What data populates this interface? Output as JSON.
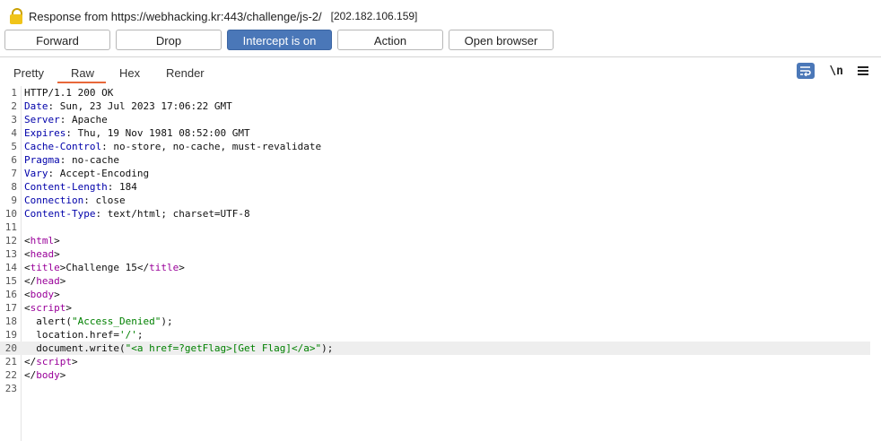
{
  "header": {
    "title": "Response from https://webhacking.kr:443/challenge/js-2/",
    "ip": "[202.182.106.159]"
  },
  "toolbar": {
    "buttons": [
      {
        "label": "Forward"
      },
      {
        "label": "Drop"
      },
      {
        "label": "Intercept is on",
        "active": true
      },
      {
        "label": "Action"
      },
      {
        "label": "Open browser"
      }
    ]
  },
  "tabs": [
    {
      "label": "Pretty"
    },
    {
      "label": "Raw",
      "active": true
    },
    {
      "label": "Hex"
    },
    {
      "label": "Render"
    }
  ],
  "tools": {
    "newline_label": "\\n"
  },
  "editor": {
    "highlighted_line": 20,
    "lines": [
      {
        "n": "1",
        "segments": [
          {
            "t": "HTTP/1.1 200 OK",
            "c": "plain"
          }
        ]
      },
      {
        "n": "2",
        "segments": [
          {
            "t": "Date",
            "c": "k"
          },
          {
            "t": ": Sun, 23 Jul 2023 17:06:22 GMT",
            "c": "plain"
          }
        ]
      },
      {
        "n": "3",
        "segments": [
          {
            "t": "Server",
            "c": "k"
          },
          {
            "t": ": Apache",
            "c": "plain"
          }
        ]
      },
      {
        "n": "4",
        "segments": [
          {
            "t": "Expires",
            "c": "k"
          },
          {
            "t": ": Thu, 19 Nov 1981 08:52:00 GMT",
            "c": "plain"
          }
        ]
      },
      {
        "n": "5",
        "segments": [
          {
            "t": "Cache-Control",
            "c": "k"
          },
          {
            "t": ": no-store, no-cache, must-revalidate",
            "c": "plain"
          }
        ]
      },
      {
        "n": "6",
        "segments": [
          {
            "t": "Pragma",
            "c": "k"
          },
          {
            "t": ": no-cache",
            "c": "plain"
          }
        ]
      },
      {
        "n": "7",
        "segments": [
          {
            "t": "Vary",
            "c": "k"
          },
          {
            "t": ": Accept-Encoding",
            "c": "plain"
          }
        ]
      },
      {
        "n": "8",
        "segments": [
          {
            "t": "Content-Length",
            "c": "k"
          },
          {
            "t": ": 184",
            "c": "plain"
          }
        ]
      },
      {
        "n": "9",
        "segments": [
          {
            "t": "Connection",
            "c": "k"
          },
          {
            "t": ": close",
            "c": "plain"
          }
        ]
      },
      {
        "n": "10",
        "segments": [
          {
            "t": "Content-Type",
            "c": "k"
          },
          {
            "t": ": text/html; charset=UTF-8",
            "c": "plain"
          }
        ]
      },
      {
        "n": "11",
        "segments": []
      },
      {
        "n": "12",
        "segments": [
          {
            "t": "<",
            "c": "plain"
          },
          {
            "t": "html",
            "c": "tg"
          },
          {
            "t": ">",
            "c": "plain"
          }
        ]
      },
      {
        "n": "13",
        "segments": [
          {
            "t": "<",
            "c": "plain"
          },
          {
            "t": "head",
            "c": "tg"
          },
          {
            "t": ">",
            "c": "plain"
          }
        ]
      },
      {
        "n": "14",
        "segments": [
          {
            "t": "<",
            "c": "plain"
          },
          {
            "t": "title",
            "c": "tg"
          },
          {
            "t": ">Challenge 15</",
            "c": "plain"
          },
          {
            "t": "title",
            "c": "tg"
          },
          {
            "t": ">",
            "c": "plain"
          }
        ]
      },
      {
        "n": "15",
        "segments": [
          {
            "t": "</",
            "c": "plain"
          },
          {
            "t": "head",
            "c": "tg"
          },
          {
            "t": ">",
            "c": "plain"
          }
        ]
      },
      {
        "n": "16",
        "segments": [
          {
            "t": "<",
            "c": "plain"
          },
          {
            "t": "body",
            "c": "tg"
          },
          {
            "t": ">",
            "c": "plain"
          }
        ]
      },
      {
        "n": "17",
        "segments": [
          {
            "t": "<",
            "c": "plain"
          },
          {
            "t": "script",
            "c": "tg"
          },
          {
            "t": ">",
            "c": "plain"
          }
        ]
      },
      {
        "n": "18",
        "segments": [
          {
            "t": "  alert(",
            "c": "plain"
          },
          {
            "t": "\"Access_Denied\"",
            "c": "st"
          },
          {
            "t": ");",
            "c": "plain"
          }
        ]
      },
      {
        "n": "19",
        "segments": [
          {
            "t": "  location.href=",
            "c": "plain"
          },
          {
            "t": "'/'",
            "c": "st"
          },
          {
            "t": ";",
            "c": "plain"
          }
        ]
      },
      {
        "n": "20",
        "segments": [
          {
            "t": "  document.write(",
            "c": "plain"
          },
          {
            "t": "\"<a href=?getFlag>[Get Flag]</a>\"",
            "c": "st"
          },
          {
            "t": ");",
            "c": "plain"
          }
        ]
      },
      {
        "n": "21",
        "segments": [
          {
            "t": "</",
            "c": "plain"
          },
          {
            "t": "script",
            "c": "tg"
          },
          {
            "t": ">",
            "c": "plain"
          }
        ]
      },
      {
        "n": "22",
        "segments": [
          {
            "t": "</",
            "c": "plain"
          },
          {
            "t": "body",
            "c": "tg"
          },
          {
            "t": ">",
            "c": "plain"
          }
        ]
      },
      {
        "n": "23",
        "segments": []
      }
    ]
  }
}
